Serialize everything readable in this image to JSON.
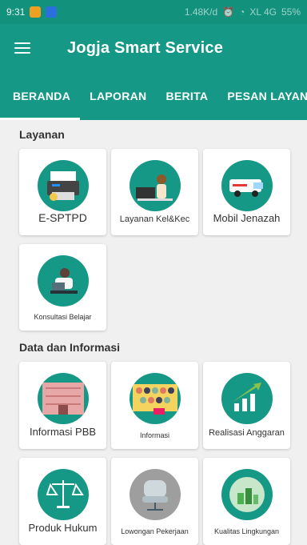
{
  "status_bar": {
    "time": "9:31",
    "speed": "1.48K/d",
    "network": "XL 4G",
    "battery": "55%"
  },
  "app_bar": {
    "title": "Jogja Smart Service"
  },
  "tabs": [
    {
      "label": "BERANDA",
      "active": true
    },
    {
      "label": "LAPORAN",
      "active": false
    },
    {
      "label": "BERITA",
      "active": false
    },
    {
      "label": "PESAN LAYANAN",
      "active": false
    }
  ],
  "sections": {
    "layanan": {
      "title": "Layanan",
      "items": [
        {
          "label": "E-SPTPD",
          "icon": "printer-icon"
        },
        {
          "label": "Layanan Kel&Kec",
          "icon": "office-worker-icon"
        },
        {
          "label": "Mobil Jenazah",
          "icon": "ambulance-icon"
        },
        {
          "label": "Konsultasi Belajar",
          "icon": "reading-student-icon"
        }
      ]
    },
    "data_informasi": {
      "title": "Data dan Informasi",
      "items": [
        {
          "label": "Informasi PBB",
          "icon": "building-icon"
        },
        {
          "label": "Informasi",
          "icon": "crowd-icon"
        },
        {
          "label": "Realisasi Anggaran",
          "icon": "bar-growth-icon"
        },
        {
          "label": "Produk Hukum",
          "icon": "scales-icon"
        },
        {
          "label": "Lowongan Pekerjaan",
          "icon": "office-chair-icon"
        },
        {
          "label": "Kualitas Lingkungan",
          "icon": "green-city-icon"
        }
      ]
    }
  },
  "colors": {
    "primary": "#159886",
    "status_bar": "#12917d",
    "background": "#f0f0f0"
  }
}
